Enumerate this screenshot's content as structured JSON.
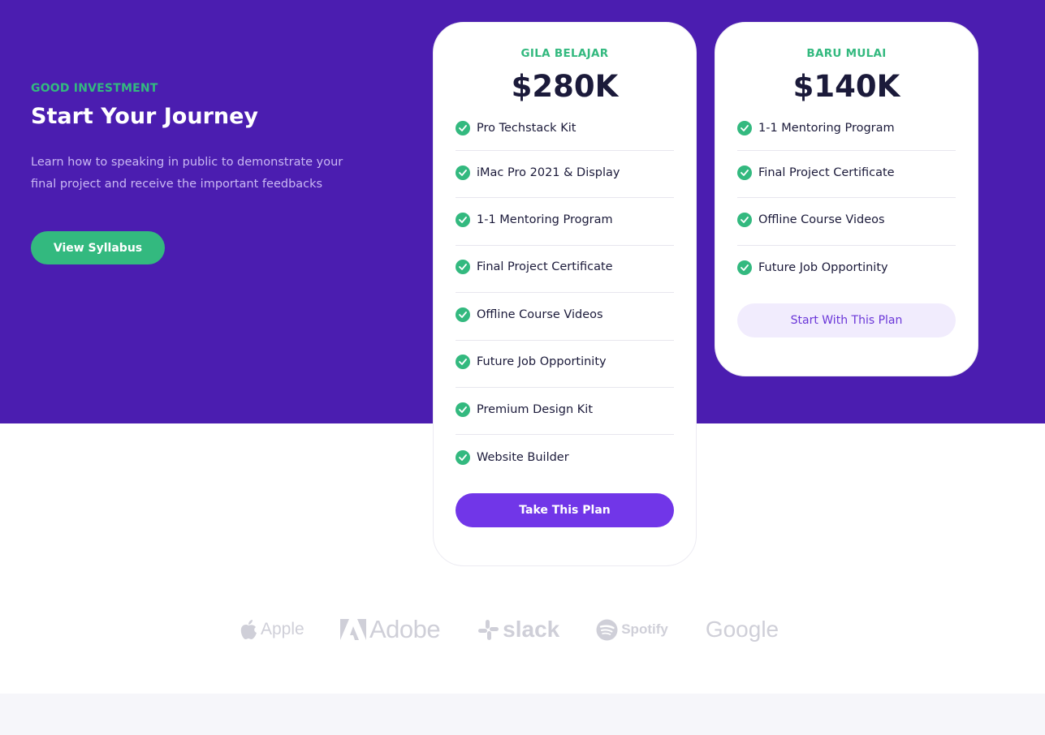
{
  "intro": {
    "eyebrow": "GOOD INVESTMENT",
    "headline": "Start Your Journey",
    "lede": "Learn how to speaking in public to demonstrate your final project and receive the important feedbacks",
    "cta_label": "View Syllabus"
  },
  "plans": [
    {
      "name": "GILA BELAJAR",
      "price": "$280K",
      "features": [
        "Pro Techstack Kit",
        "iMac Pro 2021 & Display",
        "1-1 Mentoring Program",
        "Final Project Certificate",
        "Offline Course Videos",
        "Future Job Opportinity",
        "Premium Design Kit",
        "Website Builder"
      ],
      "cta_label": "Take This Plan"
    },
    {
      "name": "BARU MULAI",
      "price": "$140K",
      "features": [
        "1-1 Mentoring Program",
        "Final Project Certificate",
        "Offline Course Videos",
        "Future Job Opportinity"
      ],
      "cta_label": "Start With This Plan"
    }
  ],
  "partners": {
    "apple": "Apple",
    "adobe": "Adobe",
    "slack": "slack",
    "spotify": "Spotify",
    "google": "Google"
  },
  "colors": {
    "hero_bg": "#4b1db0",
    "accent_green": "#33b97f",
    "primary_purple": "#7136e8",
    "text_dark": "#1b1a3a",
    "logo_gray": "#cfcfd8"
  }
}
